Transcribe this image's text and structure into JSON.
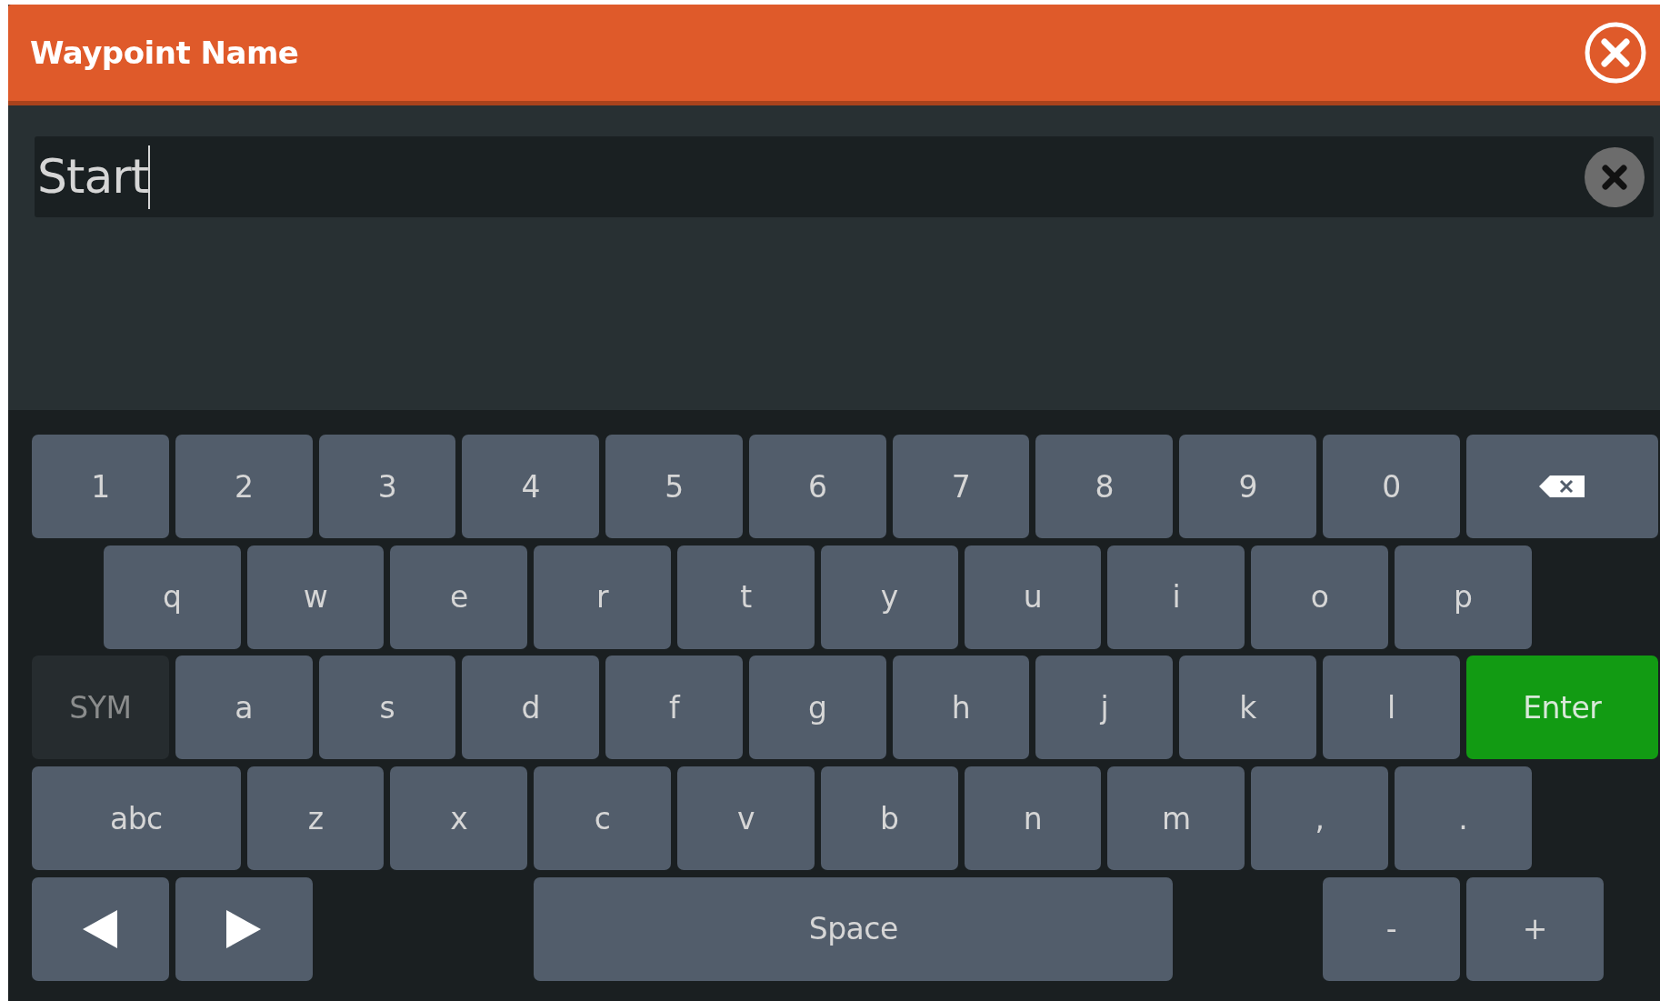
{
  "dialog": {
    "title": "Waypoint Name"
  },
  "name_field": {
    "value": "Start",
    "focused": true
  },
  "keyboard": {
    "rows": [
      {
        "keys": [
          {
            "kind": "char",
            "label": "1"
          },
          {
            "kind": "char",
            "label": "2"
          },
          {
            "kind": "char",
            "label": "3"
          },
          {
            "kind": "char",
            "label": "4"
          },
          {
            "kind": "char",
            "label": "5"
          },
          {
            "kind": "char",
            "label": "6"
          },
          {
            "kind": "char",
            "label": "7"
          },
          {
            "kind": "char",
            "label": "8"
          },
          {
            "kind": "char",
            "label": "9"
          },
          {
            "kind": "char",
            "label": "0"
          },
          {
            "kind": "backspace"
          }
        ]
      },
      {
        "keys": [
          {
            "kind": "char",
            "label": "q"
          },
          {
            "kind": "char",
            "label": "w"
          },
          {
            "kind": "char",
            "label": "e"
          },
          {
            "kind": "char",
            "label": "r"
          },
          {
            "kind": "char",
            "label": "t"
          },
          {
            "kind": "char",
            "label": "y"
          },
          {
            "kind": "char",
            "label": "u"
          },
          {
            "kind": "char",
            "label": "i"
          },
          {
            "kind": "char",
            "label": "o"
          },
          {
            "kind": "char",
            "label": "p"
          }
        ]
      },
      {
        "keys": [
          {
            "kind": "sym",
            "label": "SYM"
          },
          {
            "kind": "char",
            "label": "a"
          },
          {
            "kind": "char",
            "label": "s"
          },
          {
            "kind": "char",
            "label": "d"
          },
          {
            "kind": "char",
            "label": "f"
          },
          {
            "kind": "char",
            "label": "g"
          },
          {
            "kind": "char",
            "label": "h"
          },
          {
            "kind": "char",
            "label": "j"
          },
          {
            "kind": "char",
            "label": "k"
          },
          {
            "kind": "char",
            "label": "l"
          },
          {
            "kind": "enter",
            "label": "Enter"
          }
        ]
      },
      {
        "keys": [
          {
            "kind": "mode",
            "label": "abc"
          },
          {
            "kind": "char",
            "label": "z"
          },
          {
            "kind": "char",
            "label": "x"
          },
          {
            "kind": "char",
            "label": "c"
          },
          {
            "kind": "char",
            "label": "v"
          },
          {
            "kind": "char",
            "label": "b"
          },
          {
            "kind": "char",
            "label": "n"
          },
          {
            "kind": "char",
            "label": "m"
          },
          {
            "kind": "char",
            "label": ","
          },
          {
            "kind": "char",
            "label": "."
          }
        ]
      },
      {
        "keys": [
          {
            "kind": "left"
          },
          {
            "kind": "right"
          },
          {
            "kind": "space",
            "label": "Space"
          },
          {
            "kind": "char",
            "label": "-"
          },
          {
            "kind": "char",
            "label": "+"
          }
        ]
      }
    ]
  }
}
